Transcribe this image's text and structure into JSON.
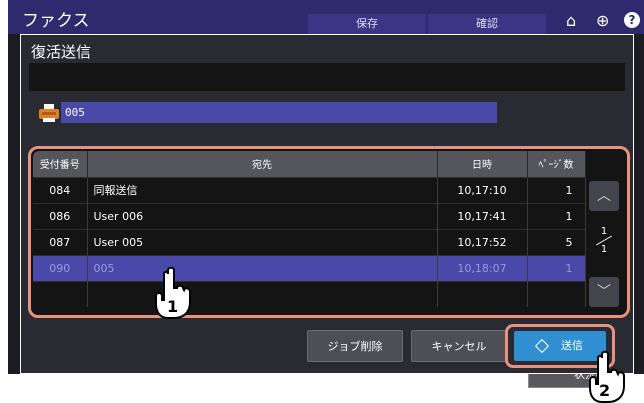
{
  "app_bar": {
    "title": "ファクス",
    "tabs": [
      "保存",
      "確認"
    ],
    "icons": [
      "home-icon",
      "globe-icon",
      "help-icon"
    ],
    "help_label": "?"
  },
  "dialog": {
    "title": "復活送信",
    "fax_number": "005"
  },
  "job_list": {
    "headers": {
      "number": "受付番号",
      "destination": "宛先",
      "datetime": "日時",
      "pages": "ﾍﾟｰｼﾞ数"
    },
    "rows": [
      {
        "number": "084",
        "destination": "同報送信",
        "datetime": "10,17:10",
        "pages": "1",
        "selected": false
      },
      {
        "number": "086",
        "destination": "User 006",
        "datetime": "10,17:41",
        "pages": "1",
        "selected": false
      },
      {
        "number": "087",
        "destination": "User 005",
        "datetime": "10,17:52",
        "pages": "5",
        "selected": false
      },
      {
        "number": "090",
        "destination": "005",
        "datetime": "10,18:07",
        "pages": "1",
        "selected": true
      }
    ],
    "pager": {
      "current": "1",
      "total": "1"
    }
  },
  "buttons": {
    "delete_job": "ジョブ削除",
    "cancel": "キャンセル",
    "send": "送信",
    "status": "状況確"
  },
  "callouts": {
    "step1": "1",
    "step2": "2"
  },
  "colors": {
    "accent_blue": "#2f8fd0",
    "selection": "#4a48a8",
    "highlight_frame": "#e8917c",
    "app_bar": "#2e2a6e"
  }
}
